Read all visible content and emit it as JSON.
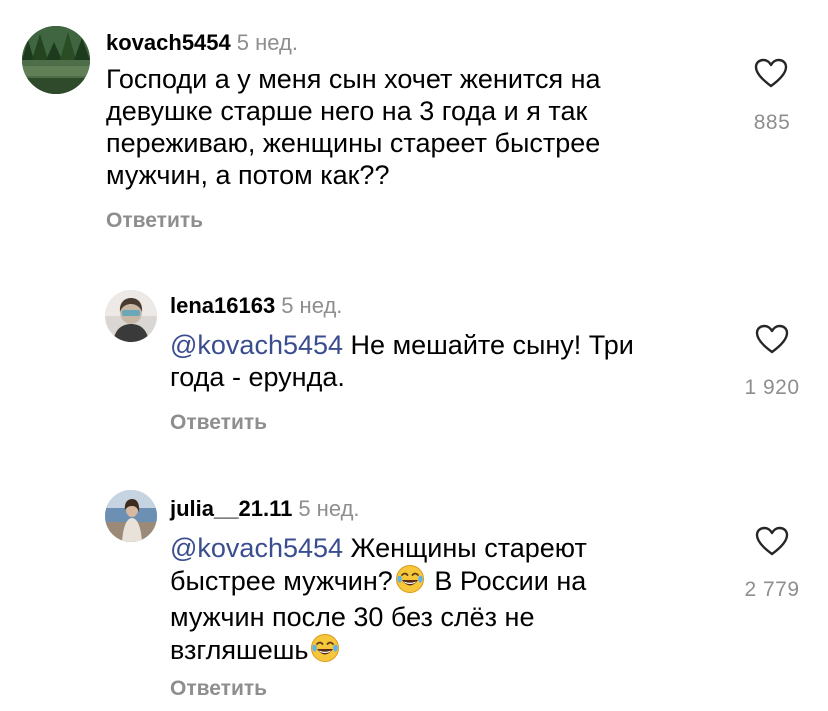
{
  "comments": [
    {
      "username": "kovach5454",
      "time": "5 нед.",
      "text": "Господи а у меня сын хочет женится на девушке старше него на 3 года и я так переживаю, женщины стареет быстрее мужчин, а потом как??",
      "reply_label": "Ответить",
      "likes": "885",
      "avatar_icon": "forest-lake-avatar"
    },
    {
      "username": "lena16163",
      "time": "5 нед.",
      "mention": "@kovach5454",
      "text": "Не мешайте сыну! Три года - ерунда.",
      "reply_label": "Ответить",
      "likes": "1 920",
      "avatar_icon": "woman-avatar"
    },
    {
      "username": "julia__21.11",
      "time": "5 нед.",
      "mention": "@kovach5454",
      "text_part1": "Женщины стареют быстрее мужчин?",
      "text_part2": "В России на мужчин после 30 без слёз не взгляшешь",
      "emoji": "face-with-tears-of-joy",
      "reply_label": "Ответить",
      "likes": "2 779",
      "avatar_icon": "beach-woman-avatar"
    }
  ],
  "colors": {
    "mention": "#3a4d8f",
    "secondary_text": "#8e8e8e"
  }
}
